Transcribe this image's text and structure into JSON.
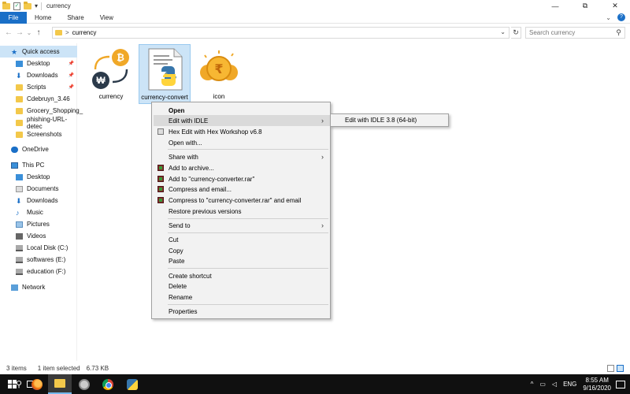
{
  "window": {
    "title": "currency",
    "controls": {
      "minimize": "—",
      "maximize": "⧉",
      "close": "✕"
    }
  },
  "ribbon": {
    "tabs": [
      "File",
      "Home",
      "Share",
      "View"
    ],
    "expand": "⌄",
    "help": "?"
  },
  "address": {
    "breadcrumb": "currency",
    "crumb_sep": ">",
    "dropdown": "⌄",
    "refresh": "↻",
    "nav": {
      "back": "←",
      "forward": "→",
      "recent": "⌄",
      "up": "↑"
    }
  },
  "search": {
    "placeholder": "Search currency",
    "icon": "⚲"
  },
  "sidebar": {
    "quick_access": "Quick access",
    "quick_items": [
      {
        "label": "Desktop",
        "pinned": true
      },
      {
        "label": "Downloads",
        "pinned": true
      },
      {
        "label": "Scripts",
        "pinned": true
      },
      {
        "label": "Cdebruyn_3.46",
        "pinned": false
      },
      {
        "label": "Grocery_Shopping_",
        "pinned": false
      },
      {
        "label": "phishing-URL-detec",
        "pinned": false
      },
      {
        "label": "Screenshots",
        "pinned": false
      }
    ],
    "pin_glyph": "📌",
    "onedrive": "OneDrive",
    "this_pc": "This PC",
    "pc_items": [
      "Desktop",
      "Documents",
      "Downloads",
      "Music",
      "Pictures",
      "Videos",
      "Local Disk (C:)",
      "softwares (E:)",
      "education (F:)"
    ],
    "network": "Network"
  },
  "files": [
    {
      "name": "currency",
      "icon": "app-currency-icon",
      "selected": false
    },
    {
      "name": "currency-convert",
      "icon": "python-file-icon",
      "selected": true
    },
    {
      "name": "icon",
      "icon": "rupee-coins-icon",
      "selected": false
    }
  ],
  "context_menu": {
    "open": "Open",
    "edit_idle": "Edit with IDLE",
    "hex_edit": "Hex Edit with Hex Workshop v6.8",
    "open_with": "Open with...",
    "share_with": "Share with",
    "add_archive": "Add to archive...",
    "add_rar": "Add to \"currency-converter.rar\"",
    "compress_email": "Compress and email...",
    "compress_rar_email": "Compress to \"currency-converter.rar\" and email",
    "restore": "Restore previous versions",
    "send_to": "Send to",
    "cut": "Cut",
    "copy": "Copy",
    "paste": "Paste",
    "create_shortcut": "Create shortcut",
    "delete": "Delete",
    "rename": "Rename",
    "properties": "Properties",
    "arrow": "›"
  },
  "submenu": {
    "item": "Edit with IDLE 3.8 (64-bit)"
  },
  "status": {
    "count": "3 items",
    "selected": "1 item selected",
    "size": "6.73 KB"
  },
  "taskbar": {
    "search_glyph": "⚲",
    "tray": {
      "up_arrow": "^",
      "network": "▭",
      "volume": "◁",
      "lang": "ENG"
    },
    "time": "8:55 AM",
    "date": "9/16/2020"
  },
  "colors": {
    "accent": "#1a6fc7",
    "selection": "#cce4f7",
    "taskbar": "#101010",
    "menu_bg": "#f2f2f2"
  }
}
